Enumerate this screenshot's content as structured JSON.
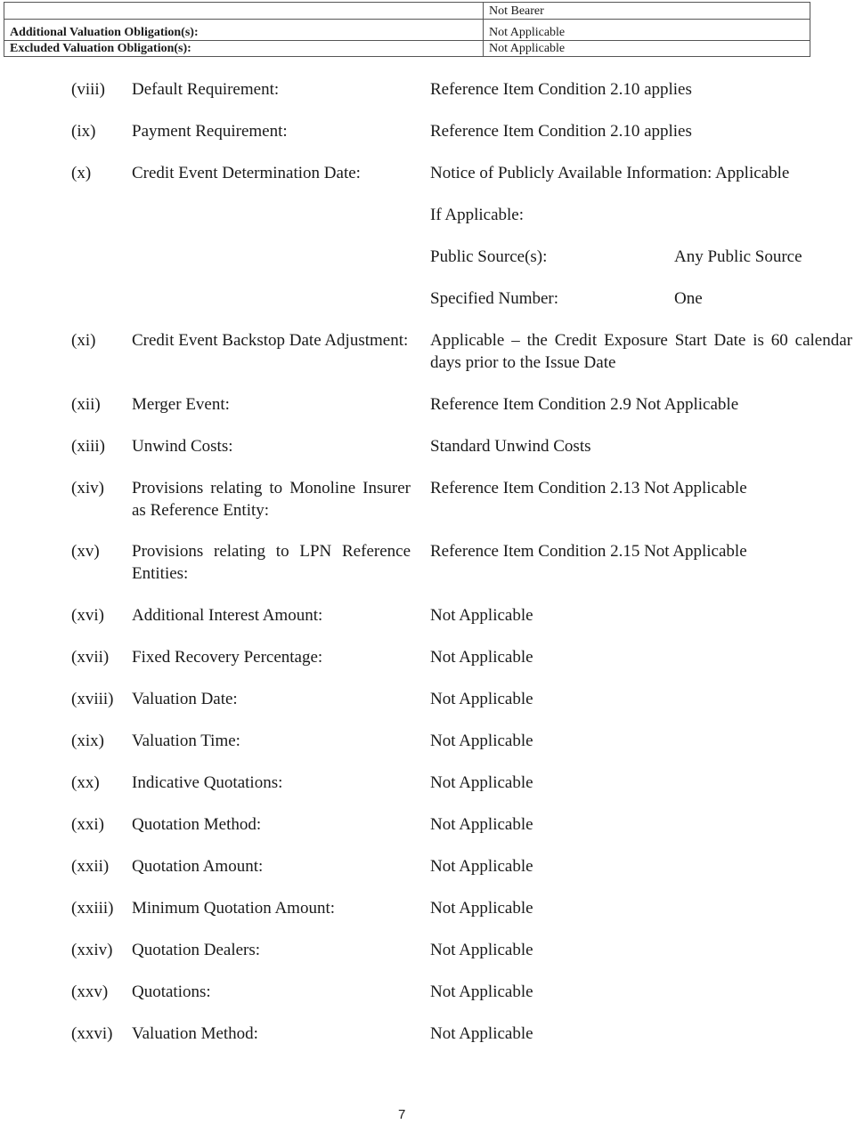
{
  "table": {
    "rows": [
      {
        "label": "",
        "value": "Not Bearer"
      },
      {
        "label": "Additional Valuation Obligation(s):",
        "value": "Not Applicable"
      },
      {
        "label": "Excluded Valuation Obligation(s):",
        "value": "Not Applicable"
      }
    ]
  },
  "items": [
    {
      "num": "(viii)",
      "label": "Default Requirement:",
      "value": "Reference Item Condition 2.10 applies"
    },
    {
      "num": "(ix)",
      "label": "Payment Requirement:",
      "value": "Reference Item Condition 2.10 applies"
    },
    {
      "num": "(x)",
      "label": "Credit Event Determination Date:",
      "value": "Notice of Publicly Available Information: Applicable",
      "if_applicable": "If Applicable:",
      "sub": [
        {
          "label": "Public Source(s):",
          "value": "Any Public Source"
        },
        {
          "label": "Specified Number:",
          "value": "One"
        }
      ]
    },
    {
      "num": "(xi)",
      "label": "Credit Event Backstop Date Adjustment:",
      "value": "Applicable – the Credit Exposure Start Date is 60 calendar days prior to the Issue Date"
    },
    {
      "num": "(xii)",
      "label": "Merger Event:",
      "value": "Reference Item Condition 2.9 Not Applicable"
    },
    {
      "num": "(xiii)",
      "label": "Unwind Costs:",
      "value": "Standard Unwind Costs"
    },
    {
      "num": "(xiv)",
      "label": "Provisions relating to Monoline Insurer as Reference Entity:",
      "value": "Reference Item Condition 2.13 Not Applicable"
    },
    {
      "num": "(xv)",
      "label": "Provisions relating to LPN Reference Entities:",
      "value": "Reference Item Condition 2.15 Not Applicable"
    },
    {
      "num": "(xvi)",
      "label": "Additional Interest Amount:",
      "value": "Not Applicable"
    },
    {
      "num": "(xvii)",
      "label": "Fixed Recovery Percentage:",
      "value": "Not Applicable"
    },
    {
      "num": "(xviii)",
      "label": "Valuation Date:",
      "value": "Not Applicable"
    },
    {
      "num": "(xix)",
      "label": "Valuation Time:",
      "value": "Not Applicable"
    },
    {
      "num": "(xx)",
      "label": "Indicative Quotations:",
      "value": "Not Applicable"
    },
    {
      "num": "(xxi)",
      "label": "Quotation Method:",
      "value": "Not Applicable"
    },
    {
      "num": "(xxii)",
      "label": "Quotation Amount:",
      "value": "Not Applicable"
    },
    {
      "num": "(xxiii)",
      "label": "Minimum Quotation Amount:",
      "value": "Not Applicable"
    },
    {
      "num": "(xxiv)",
      "label": "Quotation Dealers:",
      "value": "Not Applicable"
    },
    {
      "num": "(xxv)",
      "label": "Quotations:",
      "value": "Not Applicable"
    },
    {
      "num": "(xxvi)",
      "label": "Valuation Method:",
      "value": "Not Applicable"
    }
  ],
  "page_number": "7"
}
